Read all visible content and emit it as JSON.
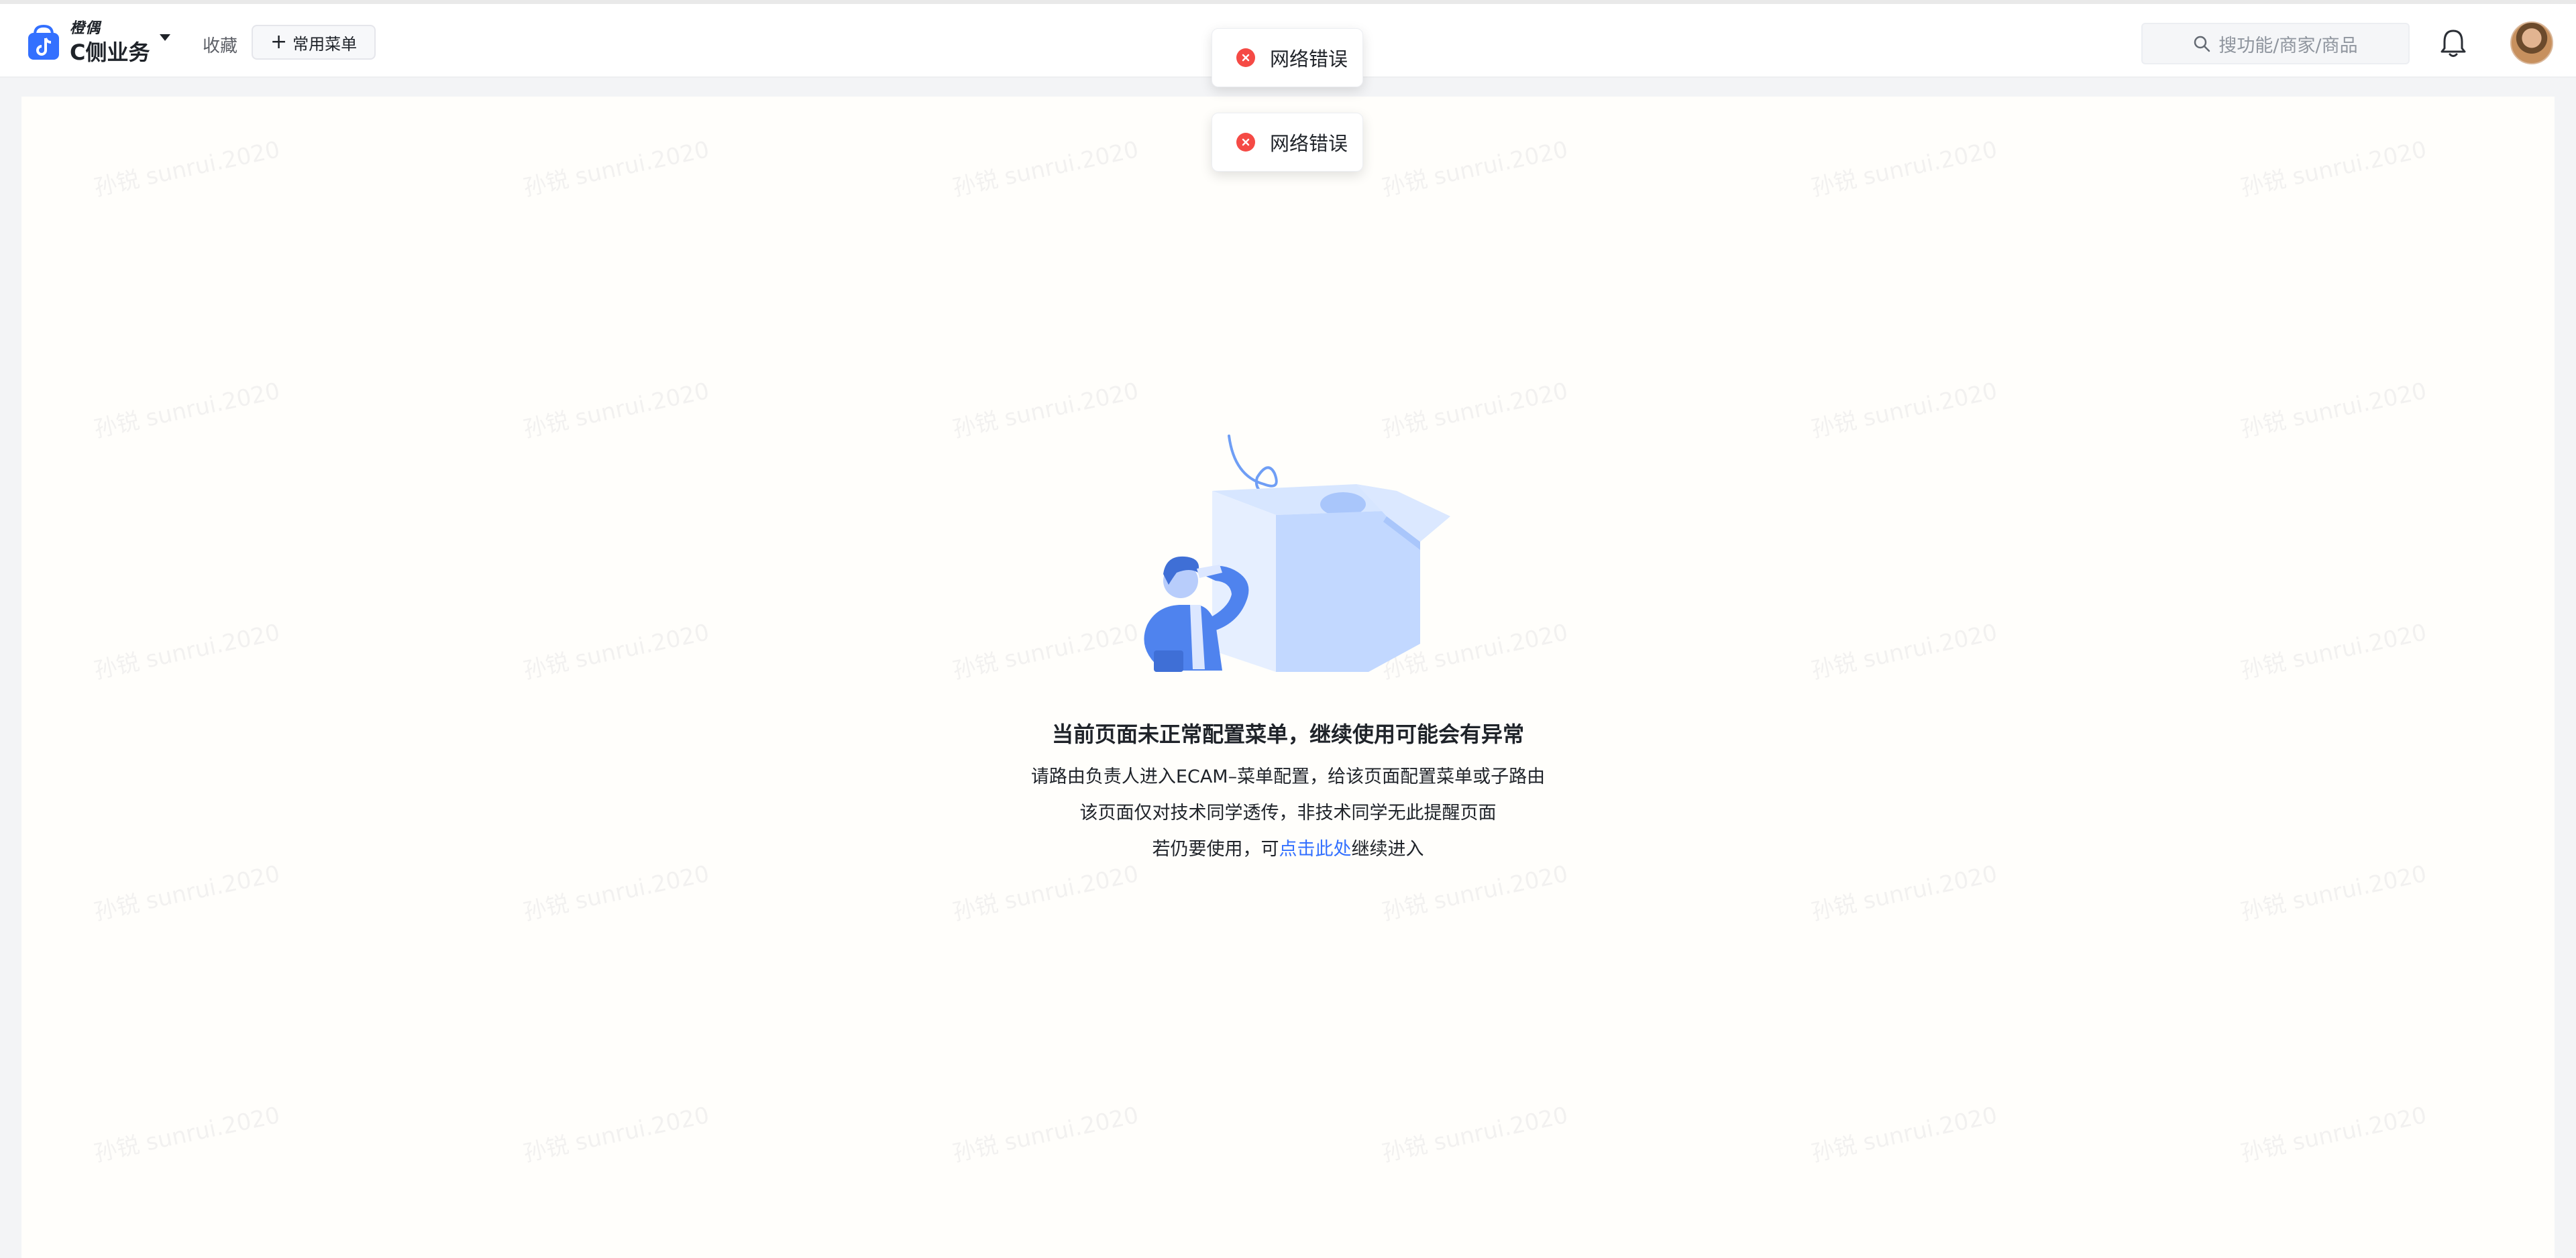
{
  "header": {
    "brand_sub": "橙偶",
    "brand_main": "C侧业务",
    "favorites_label": "收藏",
    "common_menu_label": "常用菜单",
    "search_placeholder": "搜功能/商家/商品"
  },
  "toasts": [
    {
      "message": "网络错误"
    },
    {
      "message": "网络错误"
    }
  ],
  "empty_state": {
    "title": "当前页面未正常配置菜单，继续使用可能会有异常",
    "line1": "请路由负责人进入ECAM–菜单配置，给该页面配置菜单或子路由",
    "line2": "该页面仅对技术同学透传，非技术同学无此提醒页面",
    "line3_prefix": "若仍要使用，可",
    "line3_link": "点击此处",
    "line3_suffix": "继续进入"
  },
  "watermark_text": "孙锐 sunrui.2020",
  "colors": {
    "accent": "#3370ff",
    "error": "#f54a45",
    "logo": "#3370ff"
  },
  "icons": {
    "brand": "shopping-bag-icon",
    "search": "search-icon",
    "bell": "bell-icon",
    "toast": "error-circle-icon"
  }
}
